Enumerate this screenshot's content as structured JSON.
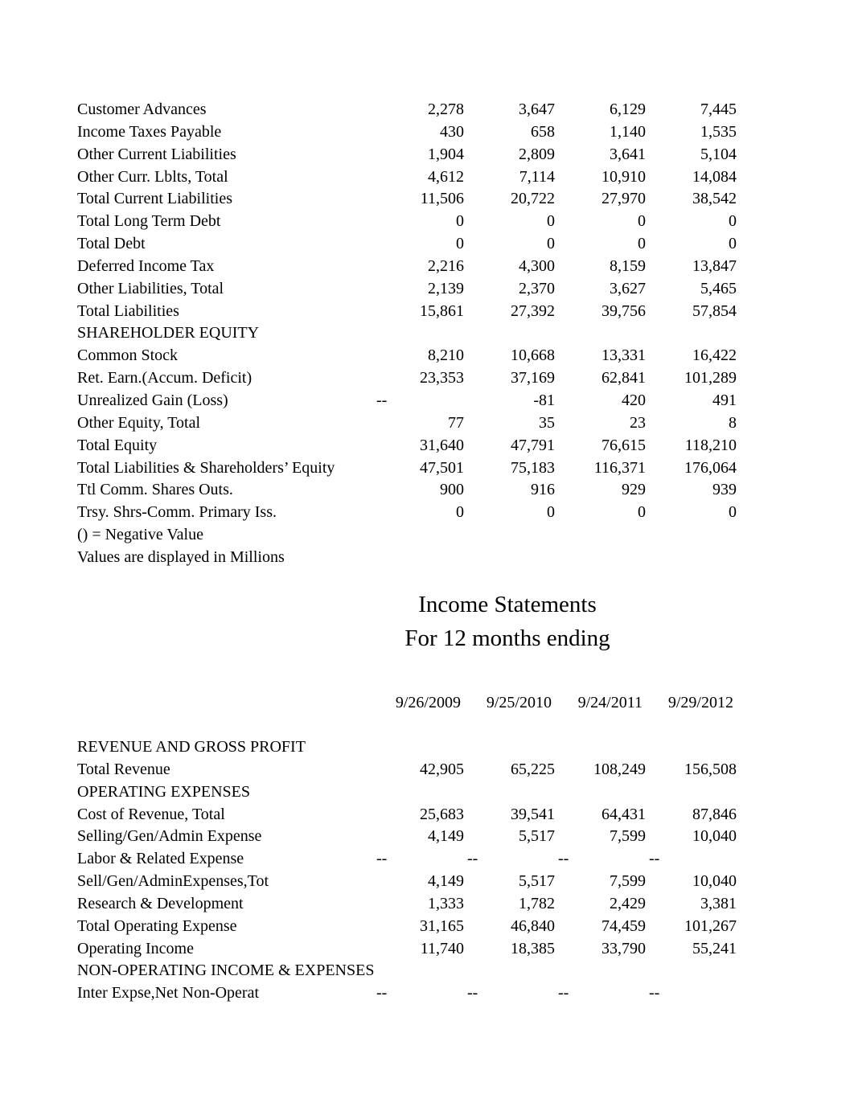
{
  "balance_sheet": {
    "rows": [
      {
        "label": "Customer Advances",
        "values": [
          "2,278",
          "3,647",
          "6,129",
          "7,445"
        ]
      },
      {
        "label": "Income Taxes Payable",
        "values": [
          "430",
          "658",
          "1,140",
          "1,535"
        ]
      },
      {
        "label": "Other Current Liabilities",
        "values": [
          "1,904",
          "2,809",
          "3,641",
          "5,104"
        ]
      },
      {
        "label": "Other Curr. Lblts, Total",
        "values": [
          "4,612",
          "7,114",
          "10,910",
          "14,084"
        ]
      },
      {
        "label": "Total Current Liabilities",
        "values": [
          "11,506",
          "20,722",
          "27,970",
          "38,542"
        ]
      },
      {
        "label": "Total Long Term Debt",
        "values": [
          "0",
          "0",
          "0",
          "0"
        ]
      },
      {
        "label": "Total Debt",
        "values": [
          "0",
          "0",
          "0",
          "0"
        ]
      },
      {
        "label": "Deferred Income Tax",
        "values": [
          "2,216",
          "4,300",
          "8,159",
          "13,847"
        ]
      },
      {
        "label": "Other Liabilities, Total",
        "values": [
          "2,139",
          "2,370",
          "3,627",
          "5,465"
        ]
      },
      {
        "label": "Total Liabilities",
        "values": [
          "15,861",
          "27,392",
          "39,756",
          "57,854"
        ]
      },
      {
        "label": "SHAREHOLDER EQUITY",
        "values": []
      },
      {
        "label": "Common Stock",
        "values": [
          "8,210",
          "10,668",
          "13,331",
          "16,422"
        ]
      },
      {
        "label": "Ret. Earn.(Accum. Deficit)",
        "values": [
          "23,353",
          "37,169",
          "62,841",
          "101,289"
        ]
      },
      {
        "label": "Unrealized Gain (Loss)",
        "values": [
          "--",
          "-81",
          "420",
          "491"
        ]
      },
      {
        "label": "Other Equity, Total",
        "values": [
          "77",
          "35",
          "23",
          "8"
        ]
      },
      {
        "label": "Total Equity",
        "values": [
          "31,640",
          "47,791",
          "76,615",
          "118,210"
        ]
      },
      {
        "label": "Total Liabilities & Shareholders’ Equity",
        "values": [
          "47,501",
          "75,183",
          "116,371",
          "176,064"
        ]
      },
      {
        "label": "Ttl Comm. Shares Outs.",
        "values": [
          "900",
          "916",
          "929",
          "939"
        ]
      },
      {
        "label": "Trsy. Shrs-Comm. Primary Iss.",
        "values": [
          "0",
          "0",
          "0",
          "0"
        ]
      },
      {
        "label": "() = Negative Value",
        "values": []
      },
      {
        "label": "Values are displayed in Millions",
        "values": []
      }
    ]
  },
  "income_statement": {
    "title": "Income Statements",
    "subtitle": "For 12 months ending",
    "dates": [
      "9/26/2009",
      "9/25/2010",
      "9/24/2011",
      "9/29/2012"
    ],
    "rows": [
      {
        "label": "REVENUE AND GROSS PROFIT",
        "values": []
      },
      {
        "label": "Total Revenue",
        "values": [
          "42,905",
          "65,225",
          "108,249",
          "156,508"
        ]
      },
      {
        "label": "OPERATING EXPENSES",
        "values": []
      },
      {
        "label": "Cost of Revenue, Total",
        "values": [
          "25,683",
          "39,541",
          "64,431",
          "87,846"
        ]
      },
      {
        "label": "Selling/Gen/Admin Expense",
        "values": [
          "4,149",
          "5,517",
          "7,599",
          "10,040"
        ]
      },
      {
        "label": "Labor & Related Expense",
        "values": [
          "--",
          "--",
          "--",
          "--"
        ]
      },
      {
        "label": "Sell/Gen/AdminExpenses,Tot",
        "values": [
          "4,149",
          "5,517",
          "7,599",
          "10,040"
        ]
      },
      {
        "label": "Research & Development",
        "values": [
          "1,333",
          "1,782",
          "2,429",
          "3,381"
        ]
      },
      {
        "label": "Total Operating Expense",
        "values": [
          "31,165",
          "46,840",
          "74,459",
          "101,267"
        ]
      },
      {
        "label": "Operating Income",
        "values": [
          "11,740",
          "18,385",
          "33,790",
          "55,241"
        ]
      },
      {
        "label": "NON-OPERATING INCOME & EXPENSES",
        "values": []
      },
      {
        "label": "Inter Expse,Net Non-Operat",
        "values": [
          "--",
          "--",
          "--",
          "--"
        ]
      }
    ]
  }
}
